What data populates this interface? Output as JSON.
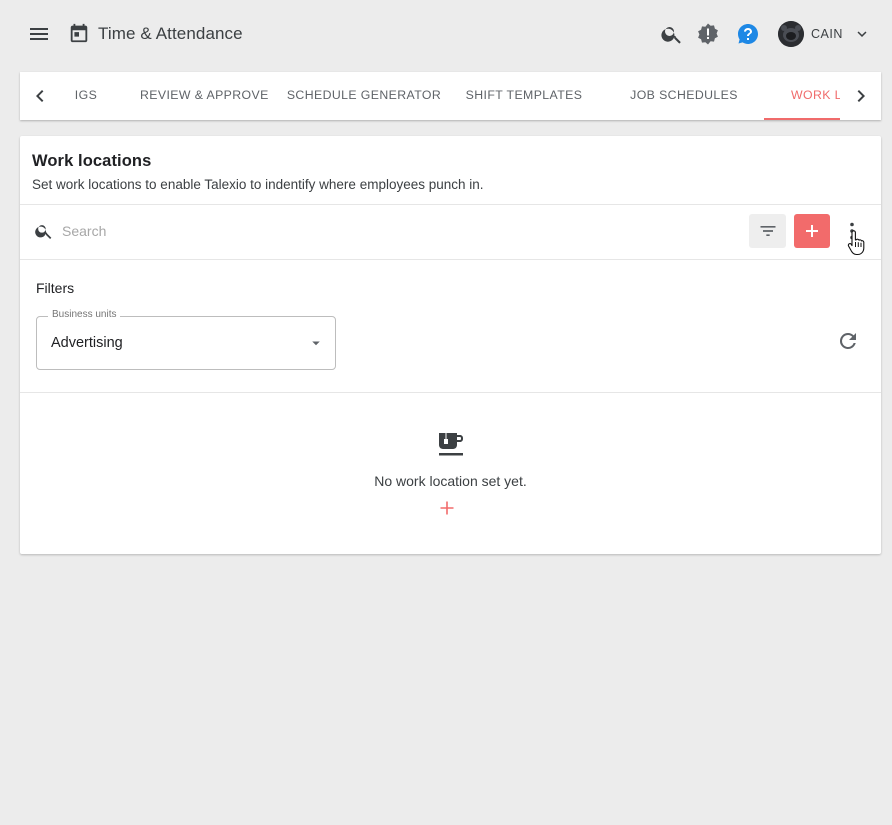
{
  "topbar": {
    "title": "Time & Attendance",
    "user_name": "CAIN",
    "icons": [
      "menu-icon",
      "calendar-icon",
      "search-icon",
      "alert-badge-icon",
      "help-icon",
      "chevron-down-icon"
    ]
  },
  "tabs": {
    "items": [
      {
        "label": "IGS"
      },
      {
        "label": "REVIEW & APPROVE"
      },
      {
        "label": "SCHEDULE GENERATOR"
      },
      {
        "label": "SHIFT TEMPLATES"
      },
      {
        "label": "JOB SCHEDULES"
      },
      {
        "label": "WORK LO"
      }
    ],
    "active_index": 5
  },
  "main": {
    "title": "Work locations",
    "subtitle": "Set work locations to enable Talexio to indentify where employees punch in.",
    "search": {
      "placeholder": "Search",
      "value": ""
    },
    "filters": {
      "label": "Filters",
      "business_units": {
        "legend": "Business units",
        "value": "Advertising"
      }
    },
    "empty_state": {
      "message": "No work location set yet."
    }
  },
  "colors": {
    "accent": "#f26b6b",
    "help_blue": "#1e88e5",
    "background": "#ececec",
    "text": "#3c4043"
  }
}
